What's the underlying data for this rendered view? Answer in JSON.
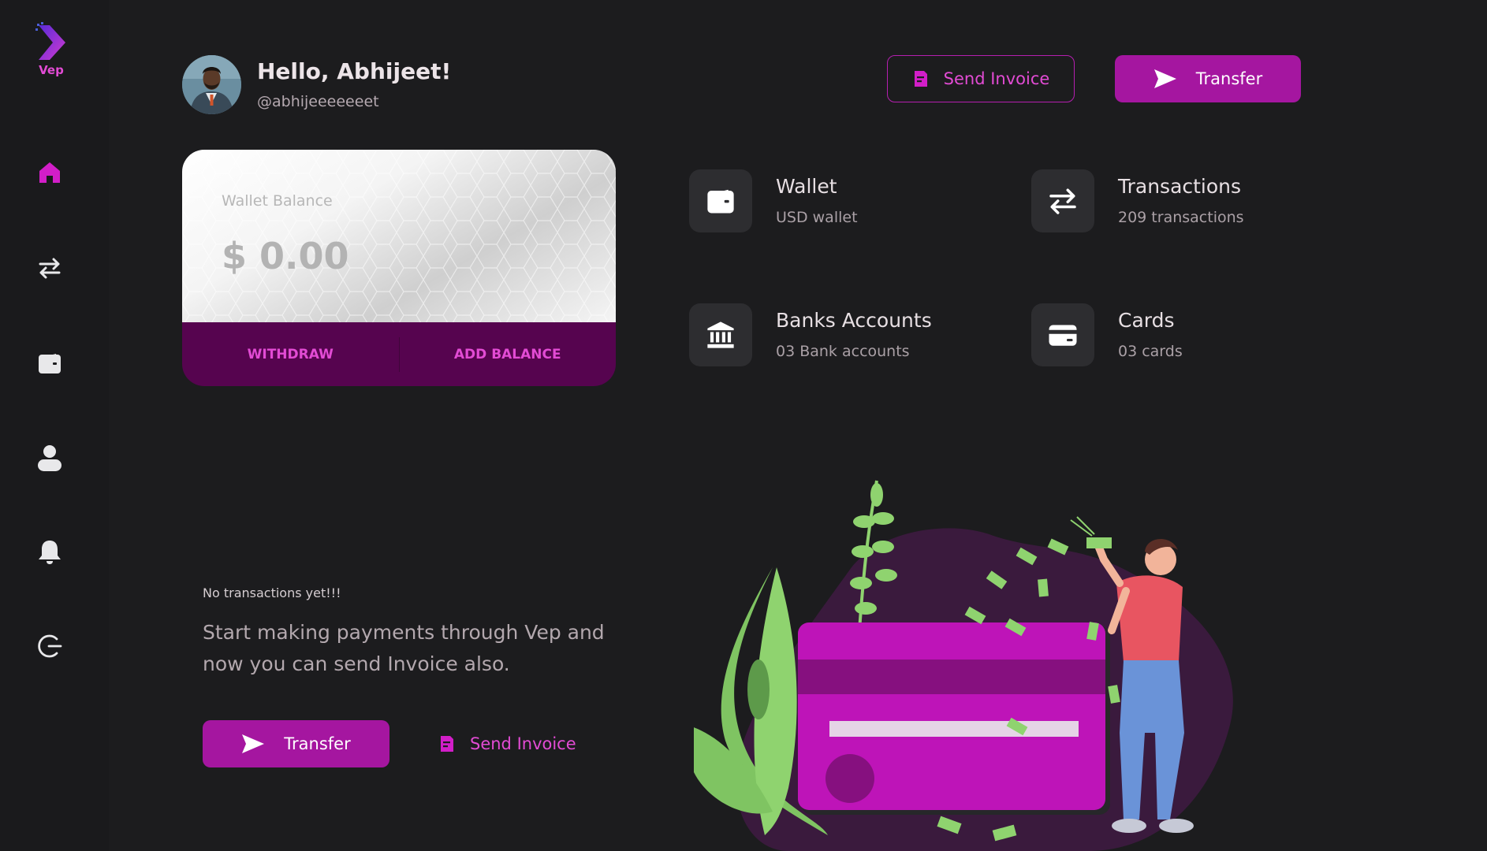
{
  "brand": {
    "name": "Vep"
  },
  "sidebar": {
    "items": [
      {
        "icon": "home-icon",
        "active": true
      },
      {
        "icon": "transfer-icon"
      },
      {
        "icon": "wallet-icon"
      },
      {
        "icon": "user-icon"
      },
      {
        "icon": "bell-icon"
      },
      {
        "icon": "logout-icon"
      }
    ]
  },
  "header": {
    "greeting": "Hello, Abhijeet!",
    "handle": "@abhijeeeeeeet",
    "send_invoice_label": "Send Invoice",
    "transfer_label": "Transfer"
  },
  "wallet_card": {
    "label": "Wallet Balance",
    "amount": "$ 0.00",
    "withdraw_label": "WITHDRAW",
    "add_balance_label": "ADD BALANCE"
  },
  "stats": [
    {
      "title": "Wallet",
      "sub": "USD wallet",
      "icon": "wallet-icon"
    },
    {
      "title": "Transactions",
      "sub": "209 transactions",
      "icon": "transfer-icon"
    },
    {
      "title": "Banks Accounts",
      "sub": "03 Bank accounts",
      "icon": "bank-icon"
    },
    {
      "title": "Cards",
      "sub": "03 cards",
      "icon": "card-icon"
    }
  ],
  "empty_state": {
    "title": "No transactions yet!!!",
    "body": "Start making payments through Vep and now you can send Invoice also.",
    "transfer_label": "Transfer",
    "send_invoice_label": "Send Invoice"
  },
  "colors": {
    "accent": "#a516a0",
    "accent_text": "#e24bd4",
    "background": "#1c1c1e",
    "card_footer": "#56044f"
  }
}
